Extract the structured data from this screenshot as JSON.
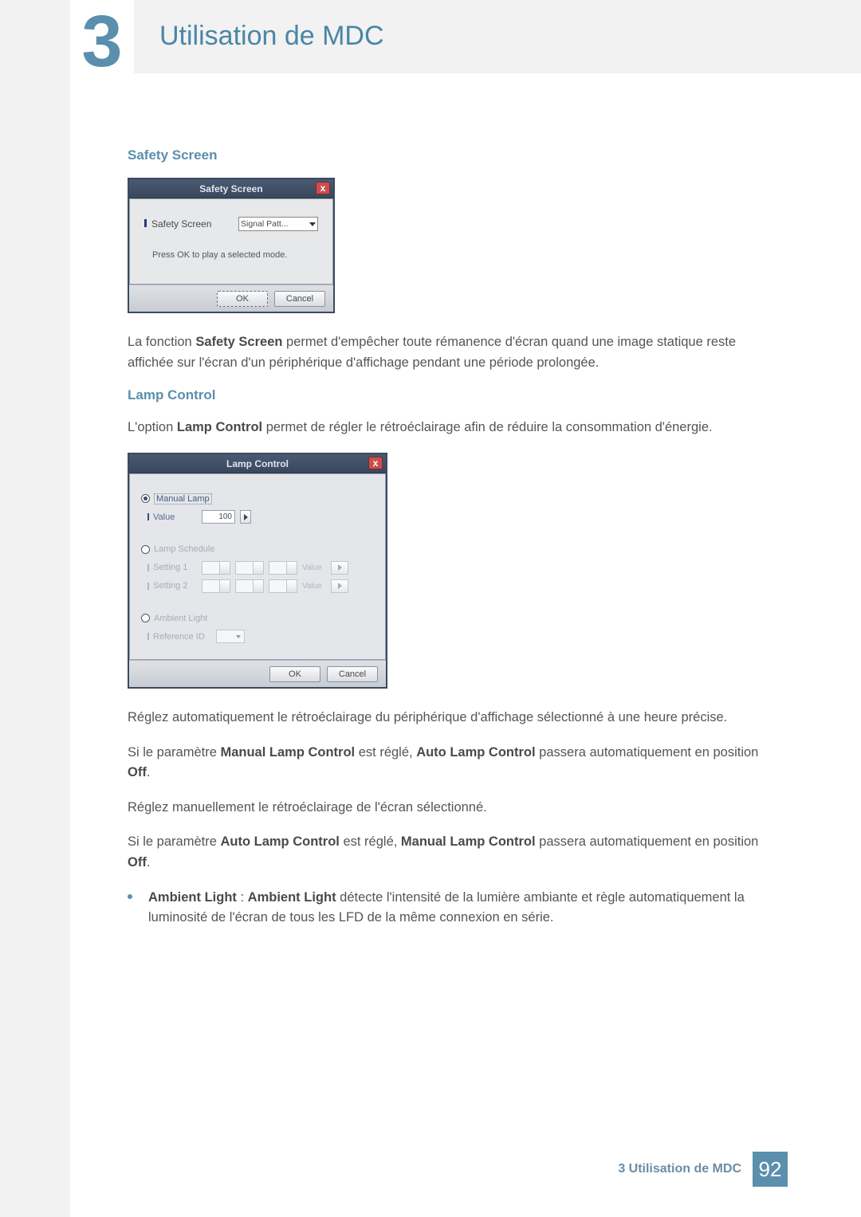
{
  "chapter": {
    "number": "3",
    "title": "Utilisation de MDC"
  },
  "safety": {
    "heading": "Safety Screen",
    "dlg": {
      "title": "Safety Screen",
      "close": "x",
      "row_label": "Safety Screen",
      "select_value": "Signal Patt...",
      "message": "Press OK to play a selected mode.",
      "ok": "OK",
      "cancel": "Cancel"
    },
    "desc_pre": "La fonction ",
    "desc_bold": "Safety Screen",
    "desc_post": " permet d'empêcher toute rémanence d'écran quand une image statique reste affichée sur l'écran d'un périphérique d'affichage pendant une période prolongée."
  },
  "lamp": {
    "heading": "Lamp Control",
    "intro_pre": "L'option ",
    "intro_bold": "Lamp Control",
    "intro_post": " permet de régler le rétroéclairage afin de réduire la consommation d'énergie.",
    "dlg": {
      "title": "Lamp Control",
      "close": "x",
      "manual_legend": "Manual Lamp",
      "value_label": "Value",
      "value_num": "100",
      "sched_legend": "Lamp Schedule",
      "setting1": "Setting 1",
      "setting2": "Setting 2",
      "value_word": "Value",
      "ambient_legend": "Ambient Light",
      "refid": "Reference ID",
      "ok": "OK",
      "cancel": "Cancel"
    },
    "p1": "Réglez automatiquement le rétroéclairage du périphérique d'affichage sélectionné à une heure précise.",
    "p2_pre": "Si le paramètre ",
    "p2_b1": "Manual Lamp Control",
    "p2_mid": " est réglé, ",
    "p2_b2": "Auto Lamp Control",
    "p2_post1": " passera automatiquement en position ",
    "p2_b3": "Off",
    "p2_post2": ".",
    "p3": "Réglez manuellement le rétroéclairage de l'écran sélectionné.",
    "p4_pre": "Si le paramètre ",
    "p4_b1": "Auto Lamp Control",
    "p4_mid": " est réglé, ",
    "p4_b2": "Manual Lamp Control",
    "p4_post1": " passera automatiquement en position ",
    "p4_b3": "Off",
    "p4_post2": ".",
    "bullet_b1": "Ambient Light",
    "bullet_sep": " : ",
    "bullet_b2": "Ambient Light",
    "bullet_text": " détecte l'intensité de la lumière ambiante et règle automatiquement la luminosité de l'écran de tous les LFD de la même connexion en série."
  },
  "footer": {
    "text": "3 Utilisation de MDC",
    "page": "92"
  }
}
